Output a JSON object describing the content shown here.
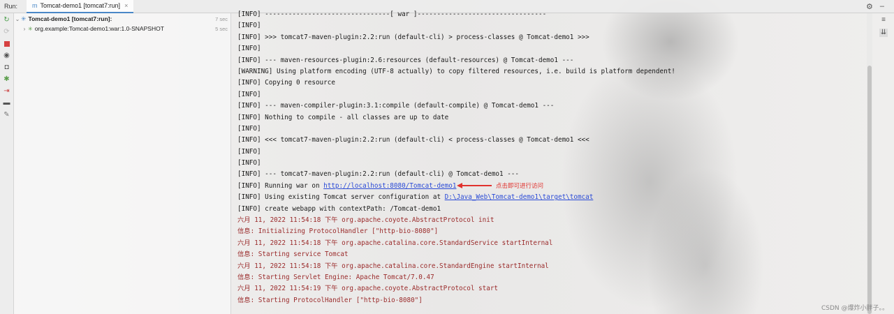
{
  "header": {
    "run_label": "Run:",
    "tab_label": "Tomcat-demo1 [tomcat7:run]",
    "settings_icon": "gear-icon",
    "minimize_icon": "minus-icon"
  },
  "tree": {
    "root": {
      "label": "Tomcat-demo1 [tomcat7:run]:",
      "time": "7 sec"
    },
    "child": {
      "label": "org.example:Tomcat-demo1:war:1.0-SNAPSHOT",
      "time": "5 sec"
    }
  },
  "console": {
    "lines": [
      "[INFO] --------------------------------[ war ]---------------------------------",
      "[INFO]",
      "[INFO] >>> tomcat7-maven-plugin:2.2:run (default-cli) > process-classes @ Tomcat-demo1 >>>",
      "[INFO]",
      "[INFO] --- maven-resources-plugin:2.6:resources (default-resources) @ Tomcat-demo1 ---",
      "[WARNING] Using platform encoding (UTF-8 actually) to copy filtered resources, i.e. build is platform dependent!",
      "[INFO] Copying 0 resource",
      "[INFO]",
      "[INFO] --- maven-compiler-plugin:3.1:compile (default-compile) @ Tomcat-demo1 ---",
      "[INFO] Nothing to compile - all classes are up to date",
      "[INFO]",
      "[INFO] <<< tomcat7-maven-plugin:2.2:run (default-cli) < process-classes @ Tomcat-demo1 <<<",
      "[INFO]",
      "[INFO]",
      "[INFO] --- tomcat7-maven-plugin:2.2:run (default-cli) @ Tomcat-demo1 ---"
    ],
    "running_prefix": "[INFO] Running war on ",
    "running_link": "http://localhost:8080/Tomcat-demo1",
    "config_prefix": "[INFO] Using existing Tomcat server configuration at ",
    "config_link": "D:\\Java_Web\\Tomcat-demo1\\target\\tomcat",
    "webapp_line": "[INFO] create webapp with contextPath: /Tomcat-demo1",
    "log_lines": [
      "六月 11, 2022 11:54:18 下午 org.apache.coyote.AbstractProtocol init",
      "信息: Initializing ProtocolHandler [\"http-bio-8080\"]",
      "六月 11, 2022 11:54:18 下午 org.apache.catalina.core.StandardService startInternal",
      "信息: Starting service Tomcat",
      "六月 11, 2022 11:54:18 下午 org.apache.catalina.core.StandardEngine startInternal",
      "信息: Starting Servlet Engine: Apache Tomcat/7.0.47",
      "六月 11, 2022 11:54:19 下午 org.apache.coyote.AbstractProtocol start",
      "信息: Starting ProtocolHandler [\"http-bio-8080\"]"
    ],
    "annotation": "点击即可进行访问"
  },
  "watermark": "CSDN @爆炸小胖子。。",
  "colors": {
    "log_red": "#9a2a2a",
    "link_blue": "#2a4ad6",
    "annotation_red": "#e0322e",
    "tab_accent": "#4a88c7"
  }
}
